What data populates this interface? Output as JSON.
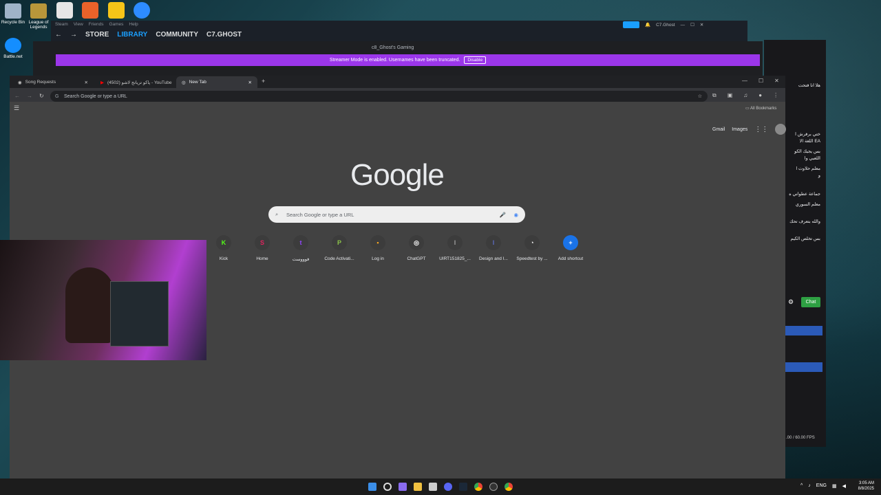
{
  "desktop": {
    "icons": [
      {
        "label": "Recycle Bin"
      },
      {
        "label": "League of Legends"
      },
      {
        "label": "Battle.net"
      }
    ]
  },
  "steam": {
    "menu": [
      "Steam",
      "View",
      "Friends",
      "Games",
      "Help"
    ],
    "nav": [
      "STORE",
      "LIBRARY",
      "COMMUNITY",
      "C7.GHOST"
    ],
    "user": "C7.Ghost"
  },
  "discord": {
    "title": "c8_Ghost's Gaming",
    "banner_text": "Streamer Mode is enabled. Usernames have been truncated.",
    "banner_button": "Disable"
  },
  "chrome": {
    "tabs": [
      {
        "label": "Song Requests"
      },
      {
        "label": "(4502) پاکو تریانج لاشو - YouTube"
      },
      {
        "label": "New Tab"
      }
    ],
    "omnibox_placeholder": "Search Google or type a URL",
    "bookmarks_label": "All Bookmarks",
    "top_links": [
      "Gmail",
      "Images"
    ],
    "logo": "Google",
    "search_placeholder": "Search Google or type a URL",
    "shortcuts": [
      {
        "label": "Kick",
        "glyph": "K",
        "color": "#53fc18"
      },
      {
        "label": "Home",
        "glyph": "S",
        "color": "#e0245e"
      },
      {
        "label": "فوووست",
        "glyph": "t",
        "color": "#9146ff"
      },
      {
        "label": "Code Activati...",
        "glyph": "P",
        "color": "#8bc34a"
      },
      {
        "label": "Log in",
        "glyph": "▪",
        "color": "#f5a623"
      },
      {
        "label": "ChatGPT",
        "glyph": "◎",
        "color": "#ffffff"
      },
      {
        "label": "UIRT151825_...",
        "glyph": "I",
        "color": "#9e9e9e"
      },
      {
        "label": "Design and I...",
        "glyph": "I",
        "color": "#5c6bc0"
      },
      {
        "label": "Speedtest by ...",
        "glyph": "◔",
        "color": "#ffffff"
      },
      {
        "label": "Add shortcut",
        "glyph": "+",
        "color": "#8ab4f8"
      }
    ]
  },
  "chat": {
    "lines": [
      "هلا انا فتحت",
      "ختي برفرش ا",
      "EA اللغة الا",
      "بس يجيك الكو",
      "اللعبي وا",
      "معلم حلاوت ا",
      "و",
      "جماعة عطواني ه",
      "معلم السوري",
      "والله بتعرف تحك",
      "بس تخلص الكيم"
    ],
    "send_label": "Chat",
    "fps": ".00 / 60.00 FPS"
  },
  "taskbar": {
    "lang": "ENG",
    "time": "3:05 AM",
    "date": "8/8/2025"
  }
}
